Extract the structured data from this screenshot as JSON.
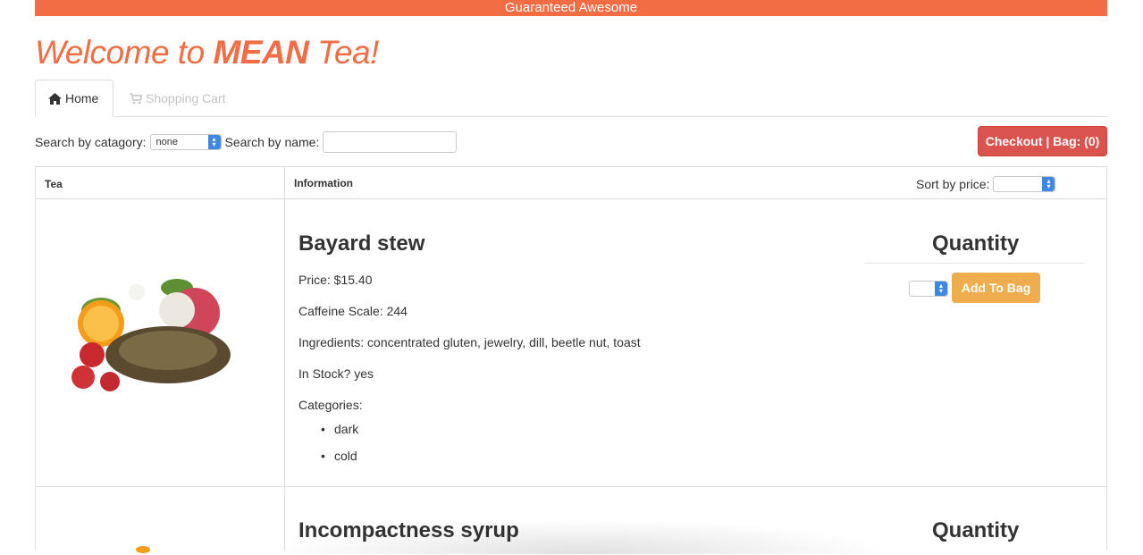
{
  "banner": {
    "text": "Guaranteed Awesome"
  },
  "header": {
    "title_pre": "Welcome to ",
    "title_bold": "MEAN",
    "title_post": " Tea!"
  },
  "tabs": [
    {
      "label": "Home",
      "icon": "home-icon",
      "active": true
    },
    {
      "label": "Shopping Cart",
      "icon": "cart-icon",
      "active": false
    }
  ],
  "search": {
    "category_label": "Search by catagory:",
    "category_value": "none",
    "name_label": "Search by name:",
    "name_value": ""
  },
  "checkout": {
    "label": "Checkout | Bag: (0)"
  },
  "table": {
    "col_tea": "Tea",
    "col_info": "Information",
    "sort_label": "Sort by price:"
  },
  "products": [
    {
      "name": "Bayard stew",
      "price": "Price: $15.40",
      "caffeine": "Caffeine Scale: 244",
      "ingredients": "Ingredients: concentrated gluten, jewelry, dill, beetle nut, toast",
      "in_stock": "In Stock? yes",
      "categories_label": "Categories:",
      "categories": [
        "dark",
        "cold"
      ],
      "quantity_label": "Quantity",
      "add_label": "Add To Bag"
    },
    {
      "name": "Incompactness syrup",
      "quantity_label": "Quantity"
    }
  ],
  "colors": {
    "brand": "#f26d44",
    "checkout": "#d9534f",
    "add": "#f0ad4e"
  }
}
